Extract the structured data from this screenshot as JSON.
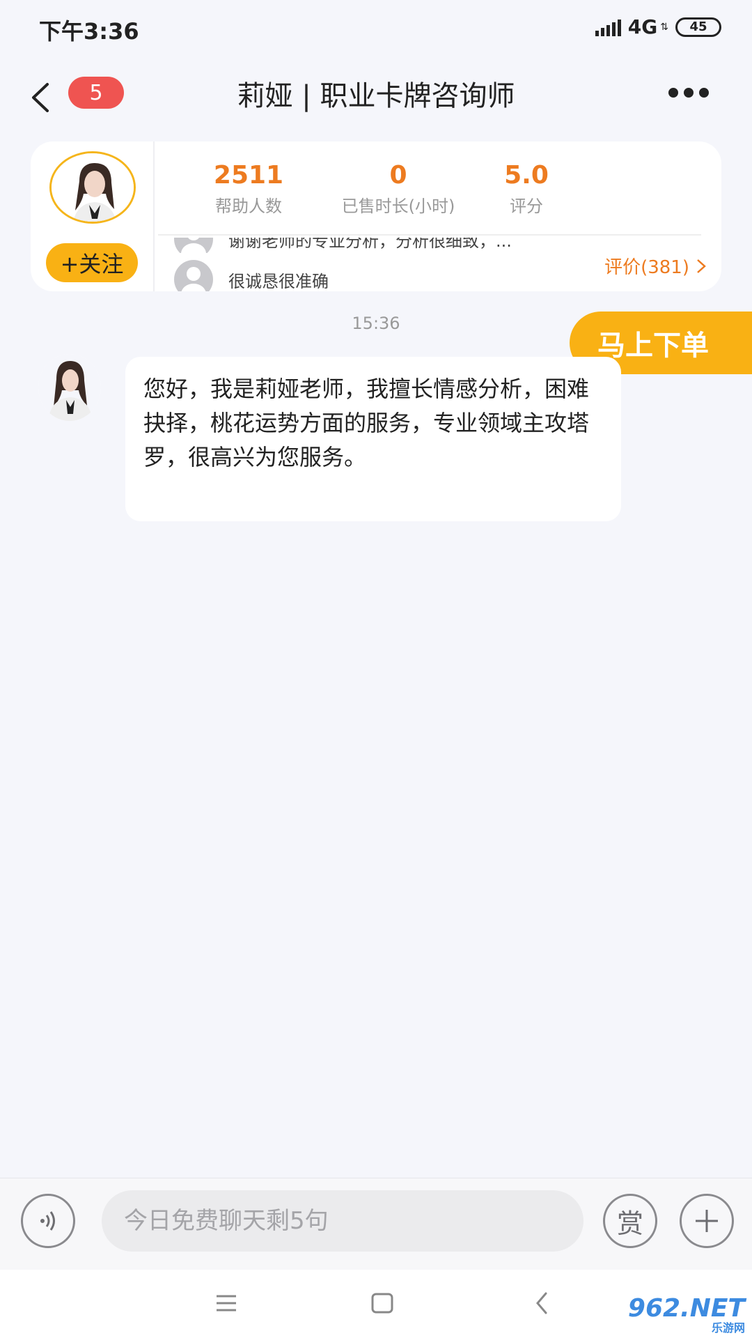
{
  "status_bar": {
    "time": "下午3:36",
    "network": "4G",
    "battery": "45"
  },
  "header": {
    "badge_count": "5",
    "title": "莉娅 | 职业卡牌咨询师"
  },
  "profile": {
    "follow_label": "+关注",
    "stats": [
      {
        "value": "2511",
        "label": "帮助人数"
      },
      {
        "value": "0",
        "label": "已售时长(小时)"
      },
      {
        "value": "5.0",
        "label": "评分"
      }
    ],
    "reviews": [
      {
        "text": "谢谢老师的专业分析，分析很细致，..."
      },
      {
        "text": "很诚恳很准确"
      }
    ],
    "reviews_link": "评价(381)"
  },
  "chat": {
    "timestamp": "15:36",
    "order_button": "马上下单",
    "message": "您好，我是莉娅老师，我擅长情感分析，困难抉择，桃花运势方面的服务，专业领域主攻塔罗，很高兴为您服务。"
  },
  "input_bar": {
    "placeholder": "今日免费聊天剩5句",
    "reward_label": "赏"
  },
  "watermark": {
    "main": "962.NET",
    "sub": "乐游网"
  },
  "colors": {
    "accent_orange": "#ed7b20",
    "button_yellow": "#f9b114",
    "badge_red": "#ef5451",
    "background": "#f5f6fb"
  }
}
